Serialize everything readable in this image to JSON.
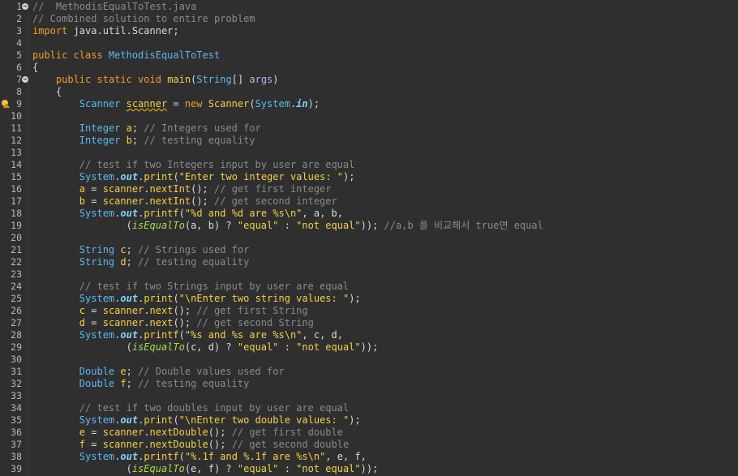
{
  "editor": {
    "colors": {
      "background": "#2f2f2f",
      "line_number": "#b8b8b8",
      "comment": "#8a8a8a",
      "keyword": "#f29c2a",
      "type": "#5db8f0",
      "method": "#f4d04a",
      "string": "#f4d04a",
      "static_field": "#7fd4ff",
      "call": "#a8dd4a"
    },
    "fold_marker_lines": [
      1,
      7
    ],
    "warning_icon_line": 9,
    "warning_icon": "warning-lightbulb-icon",
    "lines": [
      {
        "n": "1",
        "tokens": [
          {
            "c": "comment",
            "t": "//  MethodisEqualToTest.java"
          }
        ]
      },
      {
        "n": "2",
        "tokens": [
          {
            "c": "comment",
            "t": "// Combined solution to entire problem"
          }
        ]
      },
      {
        "n": "3",
        "tokens": [
          {
            "c": "kw",
            "t": "import"
          },
          {
            "c": "plain",
            "t": " java.util.Scanner;"
          }
        ]
      },
      {
        "n": "4",
        "tokens": []
      },
      {
        "n": "5",
        "tokens": [
          {
            "c": "kw",
            "t": "public class "
          },
          {
            "c": "type",
            "t": "MethodisEqualToTest"
          }
        ]
      },
      {
        "n": "6",
        "tokens": [
          {
            "c": "plain",
            "t": "{"
          }
        ]
      },
      {
        "n": "7",
        "tokens": [
          {
            "c": "plain",
            "t": "    "
          },
          {
            "c": "kw",
            "t": "public static void "
          },
          {
            "c": "method",
            "t": "main"
          },
          {
            "c": "plain",
            "t": "("
          },
          {
            "c": "type",
            "t": "String"
          },
          {
            "c": "plain",
            "t": "[] "
          },
          {
            "c": "param",
            "t": "args"
          },
          {
            "c": "plain",
            "t": ")"
          }
        ]
      },
      {
        "n": "8",
        "tokens": [
          {
            "c": "plain",
            "t": "    {"
          }
        ]
      },
      {
        "n": "9",
        "tokens": [
          {
            "c": "plain",
            "t": "        "
          },
          {
            "c": "type",
            "t": "Scanner "
          },
          {
            "c": "warnvar",
            "t": "scanner"
          },
          {
            "c": "plain",
            "t": " = "
          },
          {
            "c": "kw",
            "t": "new "
          },
          {
            "c": "method",
            "t": "Scanner"
          },
          {
            "c": "plain",
            "t": "("
          },
          {
            "c": "type",
            "t": "System"
          },
          {
            "c": "plain",
            "t": "."
          },
          {
            "c": "static",
            "t": "in"
          },
          {
            "c": "plain",
            "t": ");"
          }
        ]
      },
      {
        "n": "10",
        "tokens": []
      },
      {
        "n": "11",
        "tokens": [
          {
            "c": "plain",
            "t": "        "
          },
          {
            "c": "type",
            "t": "Integer "
          },
          {
            "c": "var",
            "t": "a"
          },
          {
            "c": "plain",
            "t": "; "
          },
          {
            "c": "comment",
            "t": "// Integers used for"
          }
        ]
      },
      {
        "n": "12",
        "tokens": [
          {
            "c": "plain",
            "t": "        "
          },
          {
            "c": "type",
            "t": "Integer "
          },
          {
            "c": "var",
            "t": "b"
          },
          {
            "c": "plain",
            "t": "; "
          },
          {
            "c": "comment",
            "t": "// testing equality"
          }
        ]
      },
      {
        "n": "13",
        "tokens": []
      },
      {
        "n": "14",
        "tokens": [
          {
            "c": "plain",
            "t": "        "
          },
          {
            "c": "comment",
            "t": "// test if two Integers input by user are equal"
          }
        ]
      },
      {
        "n": "15",
        "tokens": [
          {
            "c": "plain",
            "t": "        "
          },
          {
            "c": "type",
            "t": "System"
          },
          {
            "c": "plain",
            "t": "."
          },
          {
            "c": "static",
            "t": "out"
          },
          {
            "c": "plain",
            "t": "."
          },
          {
            "c": "method",
            "t": "print"
          },
          {
            "c": "plain",
            "t": "("
          },
          {
            "c": "string",
            "t": "\"Enter two integer values: \""
          },
          {
            "c": "plain",
            "t": ");"
          }
        ]
      },
      {
        "n": "16",
        "tokens": [
          {
            "c": "plain",
            "t": "        "
          },
          {
            "c": "var",
            "t": "a"
          },
          {
            "c": "plain",
            "t": " = "
          },
          {
            "c": "var",
            "t": "scanner"
          },
          {
            "c": "plain",
            "t": "."
          },
          {
            "c": "method",
            "t": "nextInt"
          },
          {
            "c": "plain",
            "t": "(); "
          },
          {
            "c": "comment",
            "t": "// get first integer"
          }
        ]
      },
      {
        "n": "17",
        "tokens": [
          {
            "c": "plain",
            "t": "        "
          },
          {
            "c": "var",
            "t": "b"
          },
          {
            "c": "plain",
            "t": " = "
          },
          {
            "c": "var",
            "t": "scanner"
          },
          {
            "c": "plain",
            "t": "."
          },
          {
            "c": "method",
            "t": "nextInt"
          },
          {
            "c": "plain",
            "t": "(); "
          },
          {
            "c": "comment",
            "t": "// get second integer"
          }
        ]
      },
      {
        "n": "18",
        "tokens": [
          {
            "c": "plain",
            "t": "        "
          },
          {
            "c": "type",
            "t": "System"
          },
          {
            "c": "plain",
            "t": "."
          },
          {
            "c": "static",
            "t": "out"
          },
          {
            "c": "plain",
            "t": "."
          },
          {
            "c": "method",
            "t": "printf"
          },
          {
            "c": "plain",
            "t": "("
          },
          {
            "c": "string",
            "t": "\"%d and %d are %s\\n\""
          },
          {
            "c": "plain",
            "t": ", a, b,"
          }
        ]
      },
      {
        "n": "19",
        "tokens": [
          {
            "c": "plain",
            "t": "                ("
          },
          {
            "c": "call",
            "t": "isEqualTo"
          },
          {
            "c": "plain",
            "t": "(a, b) ? "
          },
          {
            "c": "string",
            "t": "\"equal\""
          },
          {
            "c": "plain",
            "t": " : "
          },
          {
            "c": "string",
            "t": "\"not equal\""
          },
          {
            "c": "plain",
            "t": ")); "
          },
          {
            "c": "comment",
            "t": "//a,b 를 비교해서 true면 equal"
          }
        ]
      },
      {
        "n": "20",
        "tokens": []
      },
      {
        "n": "21",
        "tokens": [
          {
            "c": "plain",
            "t": "        "
          },
          {
            "c": "type",
            "t": "String "
          },
          {
            "c": "var",
            "t": "c"
          },
          {
            "c": "plain",
            "t": "; "
          },
          {
            "c": "comment",
            "t": "// Strings used for"
          }
        ]
      },
      {
        "n": "22",
        "tokens": [
          {
            "c": "plain",
            "t": "        "
          },
          {
            "c": "type",
            "t": "String "
          },
          {
            "c": "var",
            "t": "d"
          },
          {
            "c": "plain",
            "t": "; "
          },
          {
            "c": "comment",
            "t": "// testing equality"
          }
        ]
      },
      {
        "n": "23",
        "tokens": []
      },
      {
        "n": "24",
        "tokens": [
          {
            "c": "plain",
            "t": "        "
          },
          {
            "c": "comment",
            "t": "// test if two Strings input by user are equal"
          }
        ]
      },
      {
        "n": "25",
        "tokens": [
          {
            "c": "plain",
            "t": "        "
          },
          {
            "c": "type",
            "t": "System"
          },
          {
            "c": "plain",
            "t": "."
          },
          {
            "c": "static",
            "t": "out"
          },
          {
            "c": "plain",
            "t": "."
          },
          {
            "c": "method",
            "t": "print"
          },
          {
            "c": "plain",
            "t": "("
          },
          {
            "c": "string",
            "t": "\"\\nEnter two string values: \""
          },
          {
            "c": "plain",
            "t": ");"
          }
        ]
      },
      {
        "n": "26",
        "tokens": [
          {
            "c": "plain",
            "t": "        "
          },
          {
            "c": "var",
            "t": "c"
          },
          {
            "c": "plain",
            "t": " = "
          },
          {
            "c": "var",
            "t": "scanner"
          },
          {
            "c": "plain",
            "t": "."
          },
          {
            "c": "method",
            "t": "next"
          },
          {
            "c": "plain",
            "t": "(); "
          },
          {
            "c": "comment",
            "t": "// get first String"
          }
        ]
      },
      {
        "n": "27",
        "tokens": [
          {
            "c": "plain",
            "t": "        "
          },
          {
            "c": "var",
            "t": "d"
          },
          {
            "c": "plain",
            "t": " = "
          },
          {
            "c": "var",
            "t": "scanner"
          },
          {
            "c": "plain",
            "t": "."
          },
          {
            "c": "method",
            "t": "next"
          },
          {
            "c": "plain",
            "t": "(); "
          },
          {
            "c": "comment",
            "t": "// get second String"
          }
        ]
      },
      {
        "n": "28",
        "tokens": [
          {
            "c": "plain",
            "t": "        "
          },
          {
            "c": "type",
            "t": "System"
          },
          {
            "c": "plain",
            "t": "."
          },
          {
            "c": "static",
            "t": "out"
          },
          {
            "c": "plain",
            "t": "."
          },
          {
            "c": "method",
            "t": "printf"
          },
          {
            "c": "plain",
            "t": "("
          },
          {
            "c": "string",
            "t": "\"%s and %s are %s\\n\""
          },
          {
            "c": "plain",
            "t": ", c, d,"
          }
        ]
      },
      {
        "n": "29",
        "tokens": [
          {
            "c": "plain",
            "t": "                ("
          },
          {
            "c": "call",
            "t": "isEqualTo"
          },
          {
            "c": "plain",
            "t": "(c, d) ? "
          },
          {
            "c": "string",
            "t": "\"equal\""
          },
          {
            "c": "plain",
            "t": " : "
          },
          {
            "c": "string",
            "t": "\"not equal\""
          },
          {
            "c": "plain",
            "t": "));"
          }
        ]
      },
      {
        "n": "30",
        "tokens": []
      },
      {
        "n": "31",
        "tokens": [
          {
            "c": "plain",
            "t": "        "
          },
          {
            "c": "type",
            "t": "Double "
          },
          {
            "c": "var",
            "t": "e"
          },
          {
            "c": "plain",
            "t": "; "
          },
          {
            "c": "comment",
            "t": "// Double values used for"
          }
        ]
      },
      {
        "n": "32",
        "tokens": [
          {
            "c": "plain",
            "t": "        "
          },
          {
            "c": "type",
            "t": "Double "
          },
          {
            "c": "var",
            "t": "f"
          },
          {
            "c": "plain",
            "t": "; "
          },
          {
            "c": "comment",
            "t": "// testing equality"
          }
        ]
      },
      {
        "n": "33",
        "tokens": []
      },
      {
        "n": "34",
        "tokens": [
          {
            "c": "plain",
            "t": "        "
          },
          {
            "c": "comment",
            "t": "// test if two doubles input by user are equal"
          }
        ]
      },
      {
        "n": "35",
        "tokens": [
          {
            "c": "plain",
            "t": "        "
          },
          {
            "c": "type",
            "t": "System"
          },
          {
            "c": "plain",
            "t": "."
          },
          {
            "c": "static",
            "t": "out"
          },
          {
            "c": "plain",
            "t": "."
          },
          {
            "c": "method",
            "t": "print"
          },
          {
            "c": "plain",
            "t": "("
          },
          {
            "c": "string",
            "t": "\"\\nEnter two double values: \""
          },
          {
            "c": "plain",
            "t": ");"
          }
        ]
      },
      {
        "n": "36",
        "tokens": [
          {
            "c": "plain",
            "t": "        "
          },
          {
            "c": "var",
            "t": "e"
          },
          {
            "c": "plain",
            "t": " = "
          },
          {
            "c": "var",
            "t": "scanner"
          },
          {
            "c": "plain",
            "t": "."
          },
          {
            "c": "method",
            "t": "nextDouble"
          },
          {
            "c": "plain",
            "t": "(); "
          },
          {
            "c": "comment",
            "t": "// get first double"
          }
        ]
      },
      {
        "n": "37",
        "tokens": [
          {
            "c": "plain",
            "t": "        "
          },
          {
            "c": "var",
            "t": "f"
          },
          {
            "c": "plain",
            "t": " = "
          },
          {
            "c": "var",
            "t": "scanner"
          },
          {
            "c": "plain",
            "t": "."
          },
          {
            "c": "method",
            "t": "nextDouble"
          },
          {
            "c": "plain",
            "t": "(); "
          },
          {
            "c": "comment",
            "t": "// get second double"
          }
        ]
      },
      {
        "n": "38",
        "tokens": [
          {
            "c": "plain",
            "t": "        "
          },
          {
            "c": "type",
            "t": "System"
          },
          {
            "c": "plain",
            "t": "."
          },
          {
            "c": "static",
            "t": "out"
          },
          {
            "c": "plain",
            "t": "."
          },
          {
            "c": "method",
            "t": "printf"
          },
          {
            "c": "plain",
            "t": "("
          },
          {
            "c": "string",
            "t": "\"%.1f and %.1f are %s\\n\""
          },
          {
            "c": "plain",
            "t": ", e, f,"
          }
        ]
      },
      {
        "n": "39",
        "tokens": [
          {
            "c": "plain",
            "t": "                ("
          },
          {
            "c": "call",
            "t": "isEqualTo"
          },
          {
            "c": "plain",
            "t": "(e, f) ? "
          },
          {
            "c": "string",
            "t": "\"equal\""
          },
          {
            "c": "plain",
            "t": " : "
          },
          {
            "c": "string",
            "t": "\"not equal\""
          },
          {
            "c": "plain",
            "t": "));"
          }
        ]
      }
    ]
  }
}
